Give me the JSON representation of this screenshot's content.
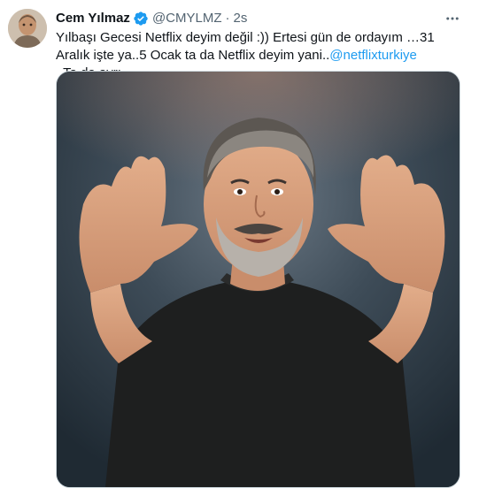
{
  "tweet": {
    "author_name": "Cem Yılmaz",
    "author_handle": "@CMYLMZ",
    "separator": "·",
    "timestamp": "2s",
    "text_before_mention": "Yılbaşı Gecesi Netflix deyim değil :)) Ertesi gün de ordayım …31 Aralık işte ya..5 Ocak ta da Netflix deyim yani..",
    "mention": "@netflixturkiye",
    "text_after_mention": "  Ta da ayrı."
  },
  "icons": {
    "verified": "verified-badge-icon",
    "more": "more-horizontal-icon"
  },
  "colors": {
    "link": "#1d9bf0",
    "secondary_text": "#536471",
    "verified": "#1d9bf0",
    "text": "#0f1419"
  }
}
